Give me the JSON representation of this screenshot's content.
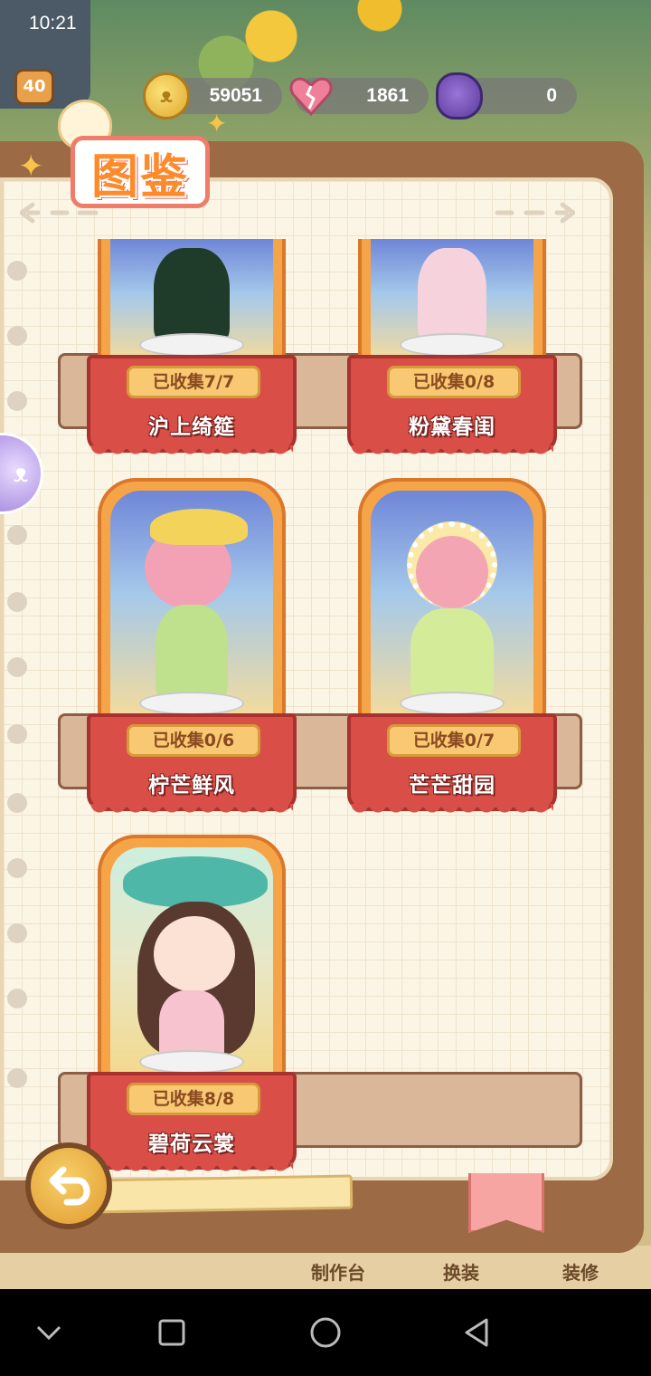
{
  "status_bar": {
    "time": "10:21"
  },
  "hud": {
    "level": "40",
    "coins": "59051",
    "hearts": "1861",
    "gloves": "0"
  },
  "page": {
    "title": "图鉴"
  },
  "collections": [
    {
      "count": "已收集7/7",
      "name": "沪上绮筵"
    },
    {
      "count": "已收集0/8",
      "name": "粉黛春闺"
    },
    {
      "count": "已收集0/6",
      "name": "柠芒鲜风"
    },
    {
      "count": "已收集0/7",
      "name": "芒芒甜园"
    },
    {
      "count": "已收集8/8",
      "name": "碧荷云裳"
    }
  ],
  "background": {
    "bottom_left": "制作台",
    "bottom_mid": "换装",
    "bottom_right": "装修"
  },
  "icons": {
    "back": "back-arrow-icon",
    "bookmark": "bookmark-icon",
    "coin": "bunny-coin-icon",
    "heart": "broken-heart-icon",
    "glove": "glove-icon"
  },
  "colors": {
    "banner": "#d94f48",
    "frame": "#f6a448",
    "title": "#ff8a2a",
    "page": "#fbf5e6"
  }
}
